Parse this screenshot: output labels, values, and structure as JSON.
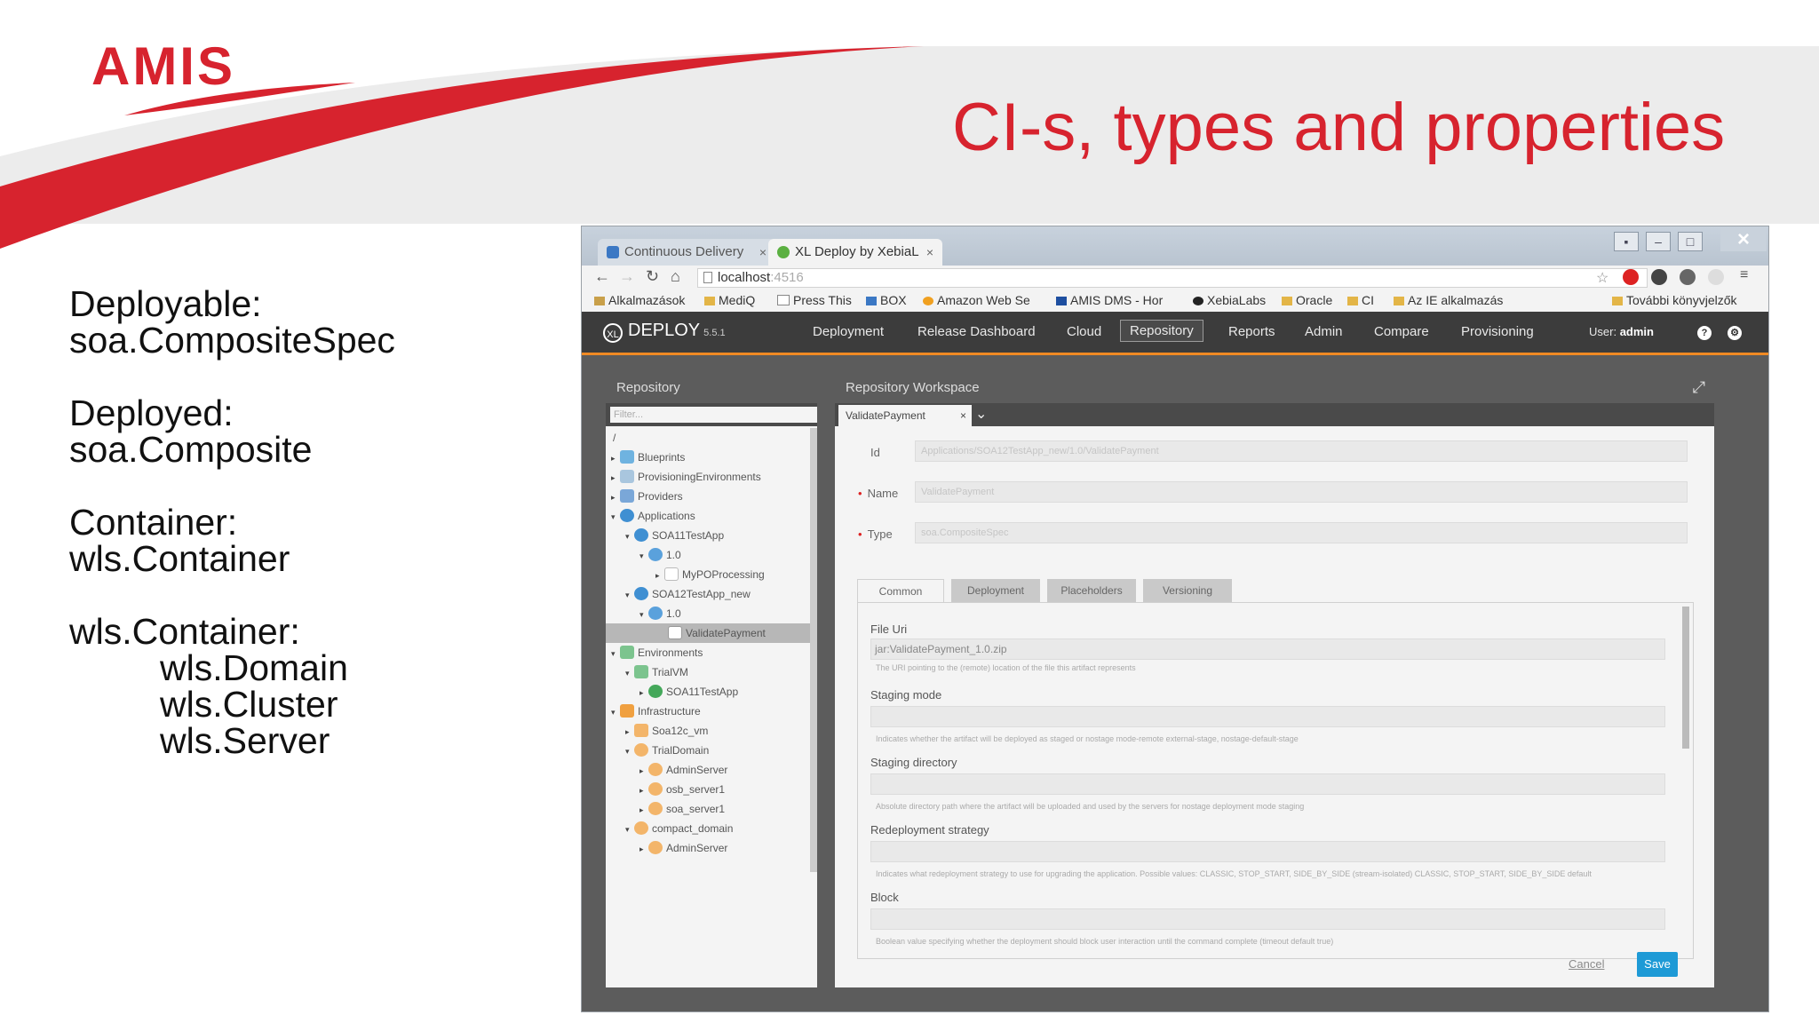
{
  "slide": {
    "logo": "AMIS",
    "title": "CI-s, types and properties",
    "bullets": [
      {
        "label": "Deployable:",
        "value": "soa.CompositeSpec"
      },
      {
        "label": "Deployed:",
        "value": "soa.Composite"
      },
      {
        "label": "Container:",
        "value": "wls.Container"
      }
    ],
    "container_group": {
      "label": "wls.Container:",
      "items": [
        "wls.Domain",
        "wls.Cluster",
        "wls.Server"
      ]
    },
    "colors": {
      "accent": "#d7232e"
    }
  },
  "browser": {
    "tabs": [
      {
        "label": "Continuous Delivery",
        "icon": "doc-icon"
      },
      {
        "label": "XL Deploy by XebiaL",
        "icon": "xl-icon"
      }
    ],
    "url": "localhost",
    "url_port": ":4516",
    "bookmarks": [
      "Alkalmazások",
      "MediQ",
      "Press This",
      "BOX",
      "Amazon Web Se",
      "AMIS DMS - Hor",
      "XebiaLabs",
      "Oracle",
      "CI",
      "Az IE alkalmazás",
      "További könyvjelzők"
    ]
  },
  "app": {
    "brand": "DEPLOY",
    "version": "5.5.1",
    "nav": [
      "Deployment",
      "Release Dashboard",
      "Cloud",
      "Repository",
      "Reports",
      "Admin",
      "Compare",
      "Provisioning"
    ],
    "active_nav": "Repository",
    "user_label": "User:",
    "user_name": "admin",
    "colors": {
      "nav_bg": "#3c3c3c",
      "nav_accent": "#f08a24",
      "save": "#1e9ad6"
    }
  },
  "repository": {
    "title": "Repository",
    "filter_placeholder": "Filter...",
    "root": "/",
    "tree": [
      {
        "label": "Blueprints",
        "level": 0
      },
      {
        "label": "ProvisioningEnvironments",
        "level": 0
      },
      {
        "label": "Providers",
        "level": 0
      },
      {
        "label": "Applications",
        "level": 0
      },
      {
        "label": "SOA11TestApp",
        "level": 1
      },
      {
        "label": "1.0",
        "level": 2
      },
      {
        "label": "MyPOProcessing",
        "level": 3
      },
      {
        "label": "SOA12TestApp_new",
        "level": 1
      },
      {
        "label": "1.0",
        "level": 2
      },
      {
        "label": "ValidatePayment",
        "level": 3
      },
      {
        "label": "Environments",
        "level": 0
      },
      {
        "label": "TrialVM",
        "level": 1
      },
      {
        "label": "SOA11TestApp",
        "level": 2
      },
      {
        "label": "Infrastructure",
        "level": 0
      },
      {
        "label": "Soa12c_vm",
        "level": 1
      },
      {
        "label": "TrialDomain",
        "level": 1
      },
      {
        "label": "AdminServer",
        "level": 2
      },
      {
        "label": "osb_server1",
        "level": 2
      },
      {
        "label": "soa_server1",
        "level": 2
      },
      {
        "label": "compact_domain",
        "level": 1
      },
      {
        "label": "AdminServer",
        "level": 2
      }
    ]
  },
  "workspace": {
    "title": "Repository Workspace",
    "tab": "ValidatePayment",
    "fields": {
      "id_label": "Id",
      "id_value": "Applications/SOA12TestApp_new/1.0/ValidatePayment",
      "name_label": "Name",
      "name_value": "ValidatePayment",
      "type_label": "Type",
      "type_value": "soa.CompositeSpec"
    },
    "prop_tabs": [
      "Common",
      "Deployment",
      "Placeholders",
      "Versioning"
    ],
    "props": {
      "file_uri_label": "File Uri",
      "file_uri_value": "jar:ValidatePayment_1.0.zip",
      "file_uri_help": "The URI pointing to the (remote) location of the file this artifact represents",
      "staging_mode_label": "Staging mode",
      "staging_mode_help": "Indicates whether the artifact will be deployed as staged or nostage mode-remote external-stage, nostage-default-stage",
      "staging_dir_label": "Staging directory",
      "staging_dir_help": "Absolute directory path where the artifact will be uploaded and used by the servers for nostage deployment mode staging",
      "redeploy_label": "Redeployment strategy",
      "redeploy_help": "Indicates what redeployment strategy to use for upgrading the application. Possible values: CLASSIC, STOP_START, SIDE_BY_SIDE (stream-isolated) CLASSIC, STOP_START, SIDE_BY_SIDE default",
      "block_label": "Block",
      "block_help": "Boolean value specifying whether the deployment should block user interaction until the command complete (timeout default true)"
    },
    "cancel": "Cancel",
    "save": "Save"
  }
}
